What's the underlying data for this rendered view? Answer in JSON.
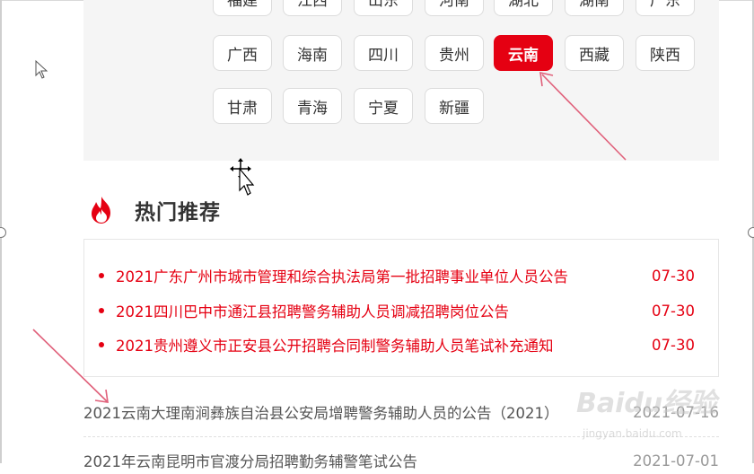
{
  "region_chips_row0": [
    {
      "label": "福建"
    },
    {
      "label": "江西"
    },
    {
      "label": "山东"
    },
    {
      "label": "河南"
    },
    {
      "label": "湖北"
    },
    {
      "label": "湖南"
    },
    {
      "label": "广东"
    }
  ],
  "region_chips_row1": [
    {
      "label": "广西"
    },
    {
      "label": "海南"
    },
    {
      "label": "四川"
    },
    {
      "label": "贵州"
    },
    {
      "label": "云南",
      "active": true
    },
    {
      "label": "西藏"
    },
    {
      "label": "陕西"
    }
  ],
  "region_chips_row2": [
    {
      "label": "甘肃"
    },
    {
      "label": "青海"
    },
    {
      "label": "宁夏"
    },
    {
      "label": "新疆"
    }
  ],
  "hot": {
    "title": "热门推荐",
    "items": [
      {
        "title": "2021广东广州市城市管理和综合执法局第一批招聘事业单位人员公告",
        "date": "07-30"
      },
      {
        "title": "2021四川巴中市通江县招聘警务辅助人员调减招聘岗位公告",
        "date": "07-30"
      },
      {
        "title": "2021贵州遵义市正安县公开招聘合同制警务辅助人员笔试补充通知",
        "date": "07-30"
      }
    ]
  },
  "list": {
    "items": [
      {
        "title": "2021云南大理南涧彝族自治县公安局增聘警务辅助人员的公告（2021）",
        "date": "2021-07-16"
      },
      {
        "title": "2021年云南昆明市官渡分局招聘勤务辅警笔试公告",
        "date": "2021-07-01"
      }
    ]
  },
  "watermark": {
    "logo": "Baidu经验",
    "url": "jingyan.baidu.com"
  },
  "colors": {
    "accent": "#e50012",
    "annotation_arrow": "#e0607a"
  }
}
